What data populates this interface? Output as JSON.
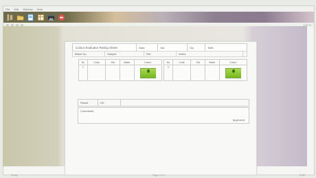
{
  "menu": [
    "File",
    "Edit",
    "Window",
    "Help"
  ],
  "toolbar": {
    "icons": [
      "tools-icon",
      "folder-icon",
      "document-icon",
      "grid-icon",
      "print-icon",
      "stop-icon"
    ]
  },
  "subbar": {
    "zoom": "100 %"
  },
  "sheet": {
    "title": "Colour Evaluator Rating Sheet",
    "head_cells": [
      "Date",
      "Job",
      "Op",
      "Shift"
    ],
    "meta": [
      "Batch No.",
      "Sample",
      "Ref",
      "Notes"
    ]
  },
  "grid_headers": [
    "No",
    "Code",
    "Std",
    "Batch",
    "Colour"
  ],
  "grid_rows": {
    "left": [
      "1",
      "",
      "",
      "",
      ""
    ],
    "right": [
      "2",
      "",
      "",
      "",
      ""
    ]
  },
  "footer": {
    "label": "Result",
    "value": "OK"
  },
  "notes": {
    "label": "Comments",
    "signature": "Approved"
  },
  "status": {
    "left": "Ready",
    "middle": "Page 1 of 1",
    "right": "NUM"
  },
  "colors": {
    "swatch": "#8fcc2f"
  }
}
